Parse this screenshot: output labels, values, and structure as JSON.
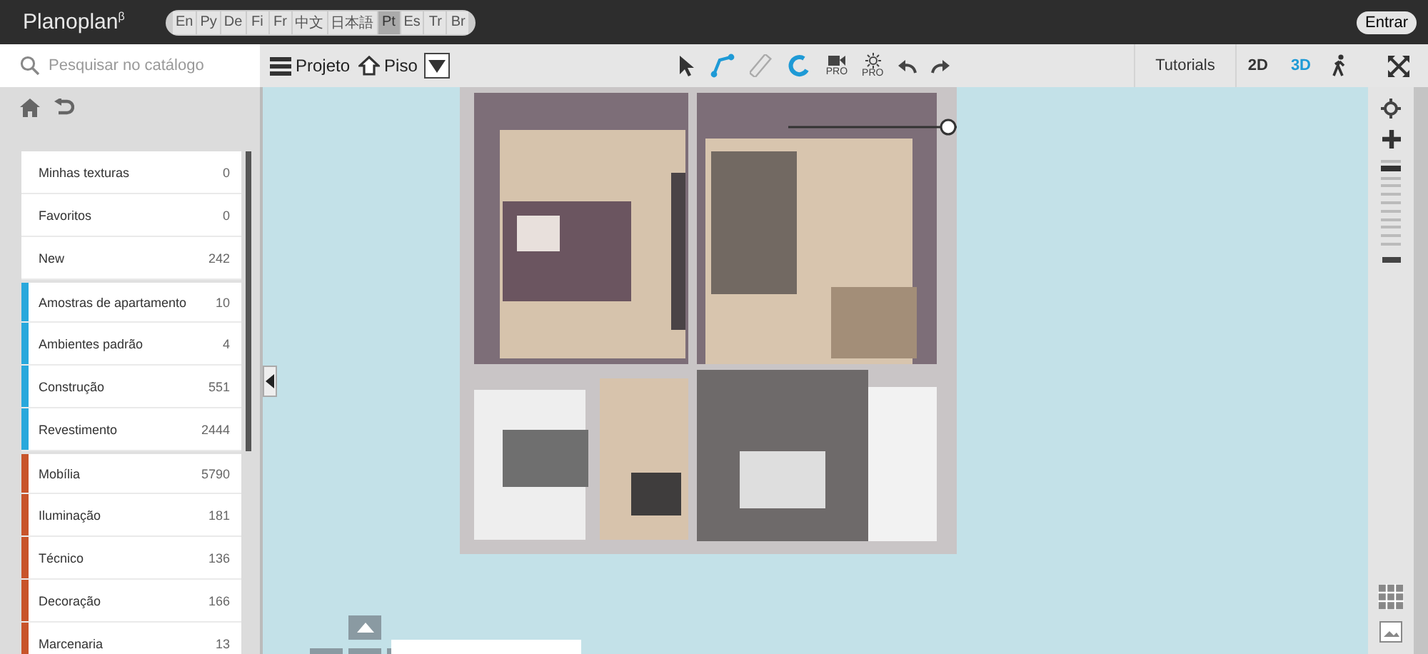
{
  "app": {
    "title": "Planoplan",
    "title_mark": "β",
    "login": "Entrar"
  },
  "languages": [
    {
      "label": "En",
      "selected": false
    },
    {
      "label": "Ру",
      "selected": false
    },
    {
      "label": "De",
      "selected": false
    },
    {
      "label": "Fi",
      "selected": false
    },
    {
      "label": "Fr",
      "selected": false
    },
    {
      "label": "中文",
      "selected": false
    },
    {
      "label": "日本語",
      "selected": false
    },
    {
      "label": "Pt",
      "selected": true
    },
    {
      "label": "Es",
      "selected": false
    },
    {
      "label": "Tr",
      "selected": false
    },
    {
      "label": "Br",
      "selected": false
    }
  ],
  "search": {
    "placeholder": "Pesquisar no catálogo"
  },
  "toolbar": {
    "project": "Projeto",
    "floor": "Piso",
    "pro_tools": [
      "PRO",
      "PRO"
    ],
    "tutorials": "Tutorials",
    "views": [
      {
        "label": "2D",
        "selected": false
      },
      {
        "label": "3D",
        "selected": true
      }
    ]
  },
  "catalog": [
    {
      "name": "Minhas texturas",
      "count": "0"
    },
    {
      "name": "Favoritos",
      "count": "0"
    },
    {
      "name": "New",
      "count": "242"
    },
    {
      "name": "Amostras de apartamento",
      "count": "10",
      "color": "#29a8dc"
    },
    {
      "name": "Ambientes padrão",
      "count": "4",
      "color": "#29a8dc"
    },
    {
      "name": "Construção",
      "count": "551",
      "color": "#29a8dc"
    },
    {
      "name": "Revestimento",
      "count": "2444",
      "color": "#29a8dc"
    },
    {
      "name": "Mobília",
      "count": "5790",
      "color": "#c8542a"
    },
    {
      "name": "Iluminação",
      "count": "181",
      "color": "#c8542a"
    },
    {
      "name": "Técnico",
      "count": "136",
      "color": "#c8542a"
    },
    {
      "name": "Decoração",
      "count": "166",
      "color": "#c8542a"
    },
    {
      "name": "Marcenaria",
      "count": "13",
      "color": "#c8542a"
    }
  ],
  "zoom": {
    "level": 0.9
  }
}
